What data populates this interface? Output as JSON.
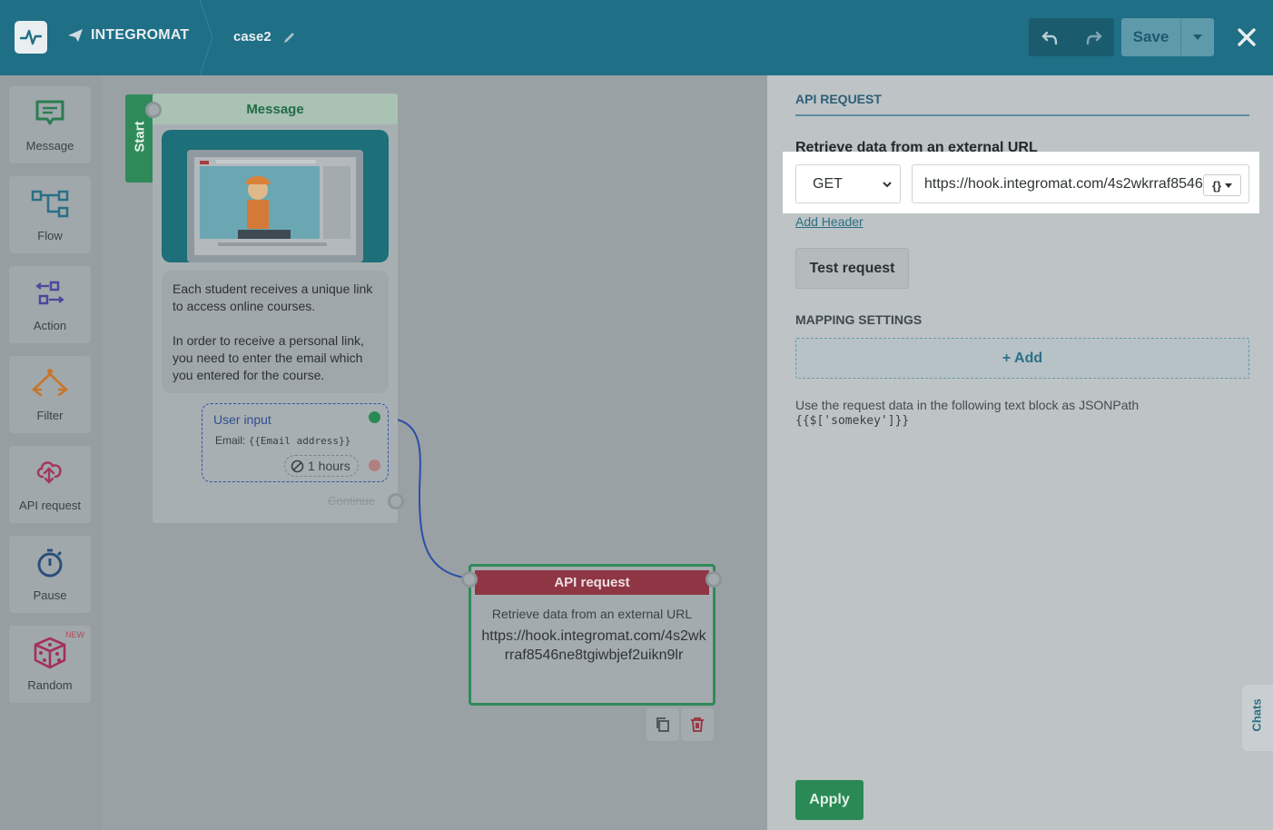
{
  "header": {
    "brand": "INTEGROMAT",
    "case_name": "case2",
    "save_label": "Save"
  },
  "toolbar": {
    "items": [
      {
        "label": "Message",
        "icon": "message-icon"
      },
      {
        "label": "Flow",
        "icon": "flow-icon"
      },
      {
        "label": "Action",
        "icon": "action-icon"
      },
      {
        "label": "Filter",
        "icon": "filter-icon"
      },
      {
        "label": "API request",
        "icon": "api-request-icon"
      },
      {
        "label": "Pause",
        "icon": "pause-icon"
      },
      {
        "label": "Random",
        "icon": "dice-icon",
        "badge": "NEW"
      }
    ]
  },
  "canvas": {
    "start_label": "Start",
    "message_node": {
      "title": "Message",
      "text_line1": "Each student receives a unique link to access online courses.",
      "text_line2": "In order to receive a personal link, you need to enter the email which you entered for the course.",
      "user_input": {
        "title": "User input",
        "email_label": "Email:",
        "email_var": "{{Email address}}",
        "timeout": "1 hours"
      },
      "continue_label": "Continue"
    },
    "api_node": {
      "title": "API request",
      "description": "Retrieve data from an external URL",
      "url": "https://hook.integromat.com/4s2wkrraf8546ne8tgiwbjef2uikn9lr"
    }
  },
  "panel": {
    "title": "API REQUEST",
    "subtitle": "Retrieve data from an external URL",
    "method": "GET",
    "url_value": "https://hook.integromat.com/4s2wkrraf8546ne8tgiwbjef2uikn9lr",
    "var_button": "{}",
    "add_header": "Add Header",
    "test_request": "Test request",
    "mapping_title": "MAPPING SETTINGS",
    "add_label": "+ Add",
    "help_text": "Use the request data in the following text block as JSONPath",
    "help_code": "{{$['somekey']}}",
    "apply_label": "Apply",
    "chats_label": "Chats"
  },
  "colors": {
    "header_bg": "#1f6f86",
    "accent_green": "#2a8a55",
    "api_red": "#8f3645",
    "link_blue": "#2c6f86"
  }
}
